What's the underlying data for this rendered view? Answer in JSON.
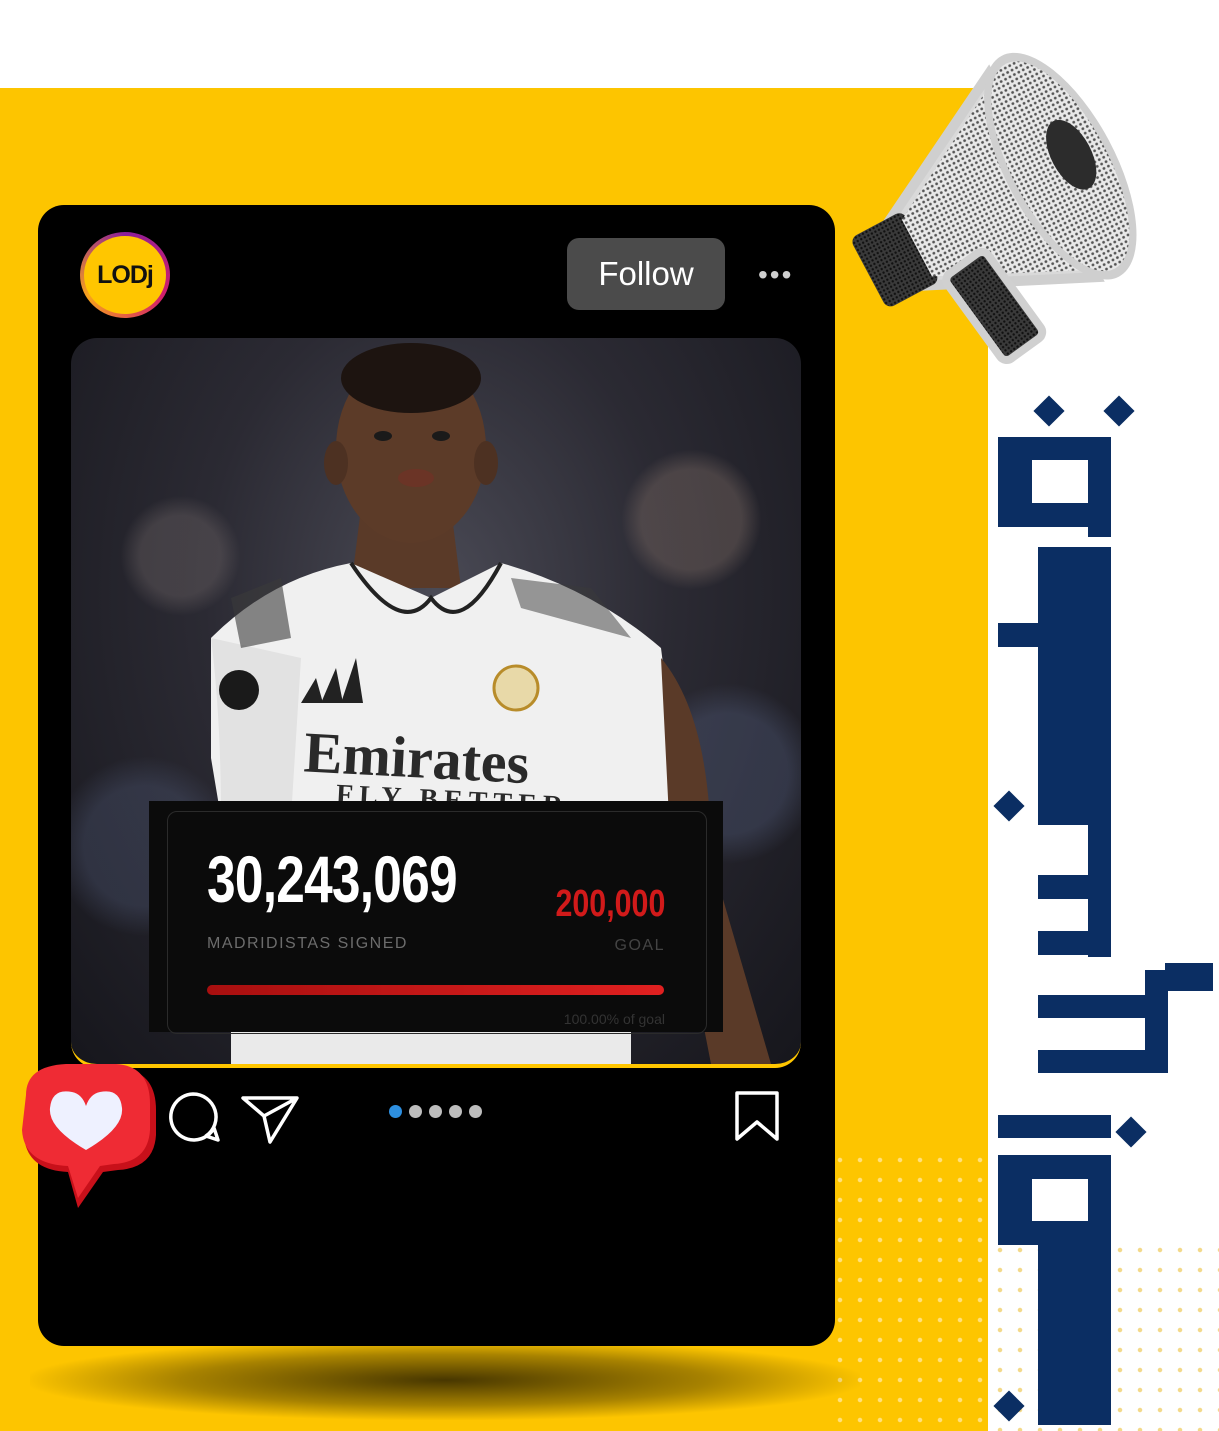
{
  "colors": {
    "background_yellow": "#fdc500",
    "card_black": "#000000",
    "follow_button": "#4b4b4b",
    "goal_red": "#d11a1a",
    "active_dot": "#2d8fe0",
    "calligraphy_navy": "#0b2e63"
  },
  "account": {
    "avatar_text": "LODj"
  },
  "header": {
    "follow_label": "Follow",
    "more_icon": "more-horizontal-icon"
  },
  "post_image": {
    "jersey_sponsor": "Emirates",
    "jersey_sponsor_sub": "FLY BETTER"
  },
  "stat": {
    "count": "30,243,069",
    "count_label": "MADRIDISTAS SIGNED",
    "goal": "200,000",
    "goal_label": "GOAL",
    "progress_fraction": 1.0,
    "progress_caption": "100.00% of goal"
  },
  "actions": {
    "like_icon": "heart-icon",
    "comment_icon": "comment-icon",
    "share_icon": "send-icon",
    "save_icon": "bookmark-icon"
  },
  "carousel": {
    "count": 5,
    "active_index": 0
  },
  "decor": {
    "megaphone_icon": "megaphone-icon"
  }
}
